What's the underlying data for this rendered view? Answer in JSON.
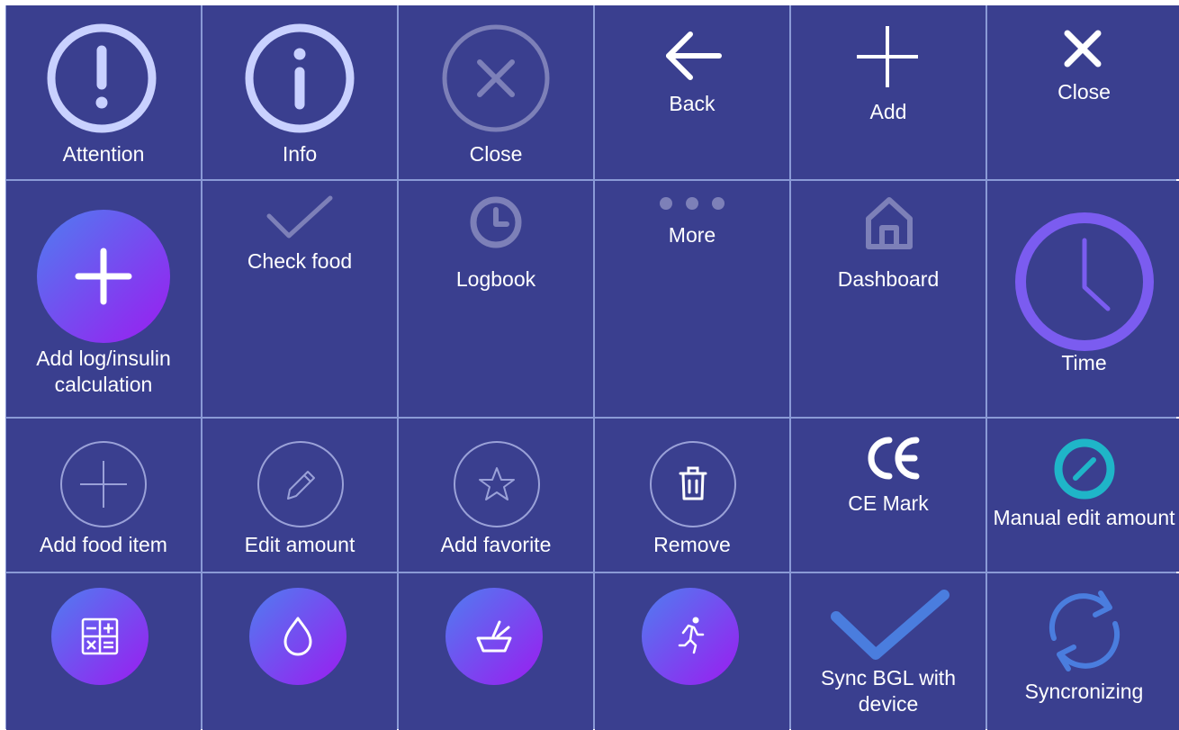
{
  "colors": {
    "background": "#3a3f8f",
    "grid_line": "#8a9ad6",
    "icon_light": "#c9d1ff",
    "icon_dim": "#7d80b8",
    "gradient_start": "#4f7df0",
    "gradient_end": "#9b1cf0",
    "time_clock": "#7b5cf0",
    "teal": "#1fb5c8",
    "sync_blue": "#4a7dde"
  },
  "rows": [
    [
      {
        "label": "Attention",
        "icon": "attention-icon"
      },
      {
        "label": "Info",
        "icon": "info-icon"
      },
      {
        "label": "Close",
        "icon": "close-circle-icon"
      },
      {
        "label": "Back",
        "icon": "back-arrow-icon"
      },
      {
        "label": "Add",
        "icon": "plus-icon"
      },
      {
        "label": "Close",
        "icon": "close-x-icon"
      }
    ],
    [
      {
        "label": "Add log/insulin calculation",
        "icon": "add-log-gradient-icon"
      },
      {
        "label": "Check food",
        "icon": "checkmark-icon"
      },
      {
        "label": "Logbook",
        "icon": "clock-small-icon"
      },
      {
        "label": "More",
        "icon": "more-dots-icon"
      },
      {
        "label": "Dashboard",
        "icon": "home-icon"
      },
      {
        "label": "Time",
        "icon": "time-clock-icon"
      }
    ],
    [
      {
        "label": "Add food item",
        "icon": "add-circle-outline-icon"
      },
      {
        "label": "Edit amount",
        "icon": "pencil-circle-icon"
      },
      {
        "label": "Add favorite",
        "icon": "star-circle-icon"
      },
      {
        "label": "Remove",
        "icon": "trash-circle-icon"
      },
      {
        "label": "CE Mark",
        "icon": "ce-mark-icon"
      },
      {
        "label": "Manual edit amount",
        "icon": "manual-edit-icon"
      }
    ],
    [
      {
        "label": "",
        "icon": "calculator-icon"
      },
      {
        "label": "",
        "icon": "drop-icon"
      },
      {
        "label": "",
        "icon": "food-bowl-icon"
      },
      {
        "label": "",
        "icon": "running-icon"
      },
      {
        "label": "Sync BGL with device",
        "icon": "sync-check-icon"
      },
      {
        "label": "Syncronizing",
        "icon": "sync-arrows-icon"
      }
    ]
  ]
}
